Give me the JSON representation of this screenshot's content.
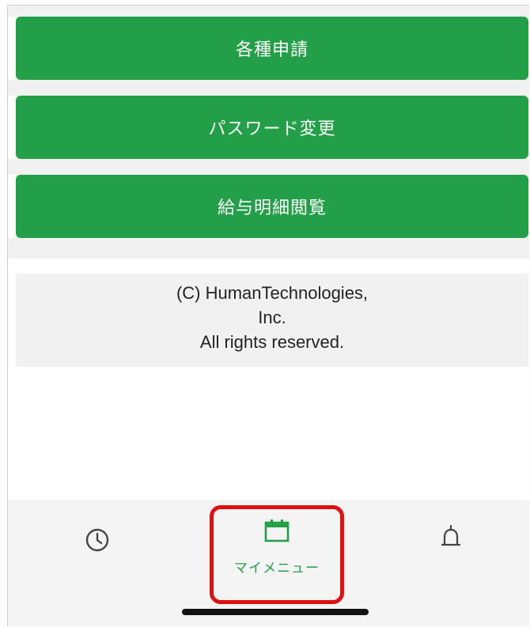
{
  "menu": {
    "buttons": [
      {
        "label": "各種申請"
      },
      {
        "label": "パスワード変更"
      },
      {
        "label": "給与明細閲覧"
      }
    ]
  },
  "footer": {
    "lines": [
      "(C) HumanTechnologies,",
      "Inc.",
      "All rights reserved."
    ]
  },
  "tabbar": {
    "items": [
      {
        "icon": "clock-icon",
        "label": ""
      },
      {
        "icon": "calendar-icon",
        "label": "マイメニュー",
        "selected": true
      },
      {
        "icon": "bell-icon",
        "label": ""
      }
    ]
  },
  "colors": {
    "accent": "#23a047",
    "highlight_border": "#e01010"
  }
}
